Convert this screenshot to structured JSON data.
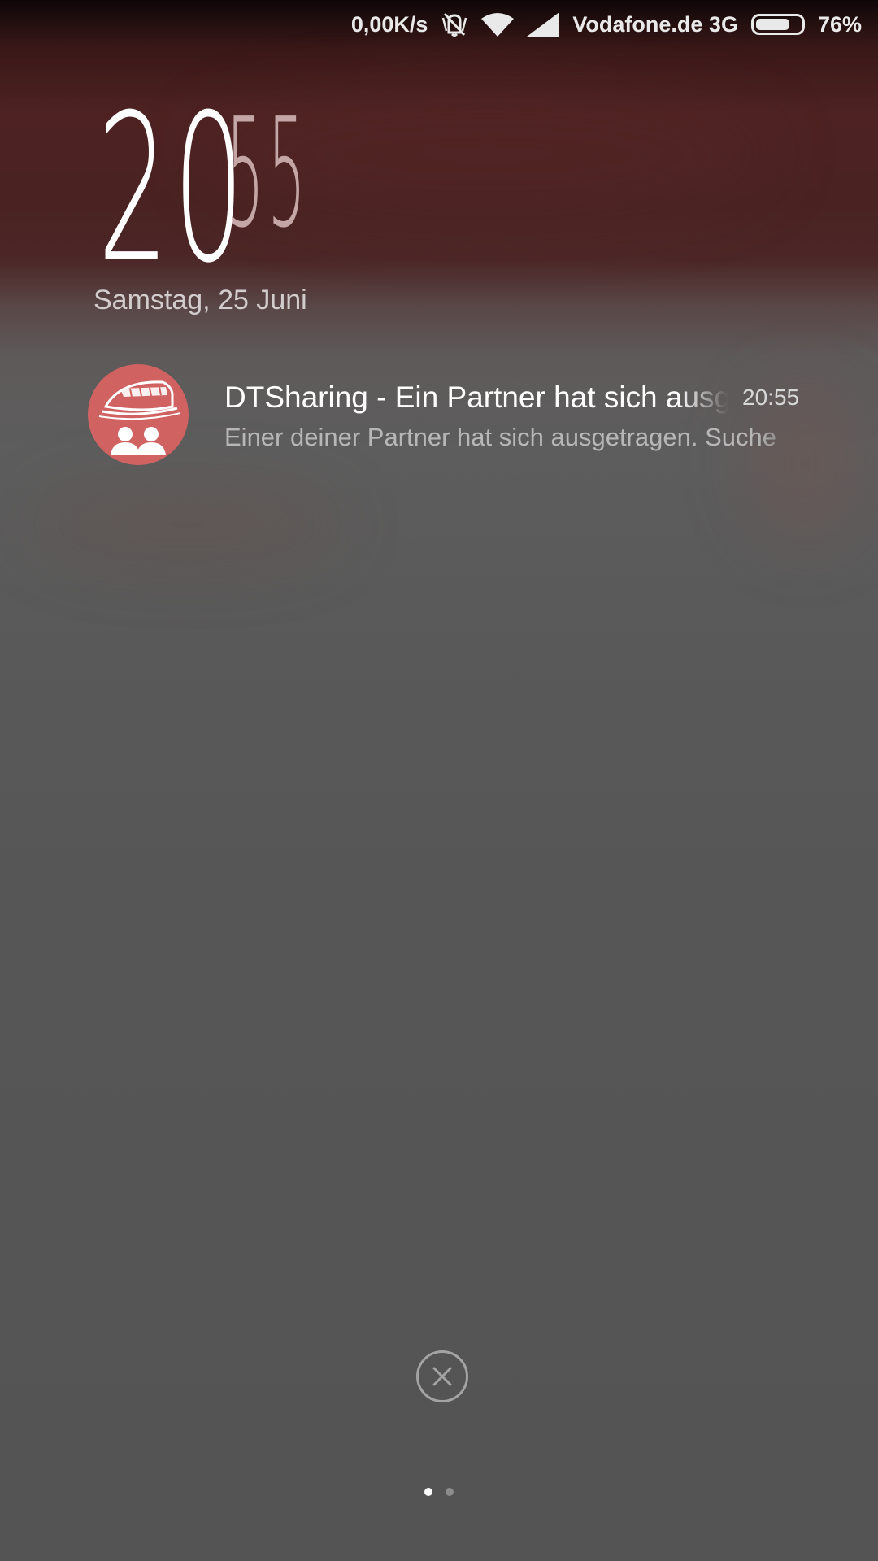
{
  "status_bar": {
    "net_speed": "0,00K/s",
    "carrier": "Vodafone.de 3G",
    "battery_percent_label": "76%",
    "battery_level": 0.76,
    "icons": [
      "vibrate-off-icon",
      "wifi-icon",
      "signal-icon",
      "battery-icon"
    ]
  },
  "clock": {
    "hours": "20",
    "minutes": "55"
  },
  "date": "Samstag, 25 Juni",
  "notification": {
    "icon": "dtsharing-app-icon",
    "title": "DTSharing - Ein Partner hat sich ausgetragen",
    "time": "20:55",
    "body": "Einer deiner Partner hat sich ausgetragen. Suche"
  },
  "clear_all": {
    "icon": "close-icon"
  },
  "pages": {
    "count": 2,
    "active": 0
  },
  "colors": {
    "icon_background": "#d06262",
    "minutes_color": "#c4a6a6"
  }
}
